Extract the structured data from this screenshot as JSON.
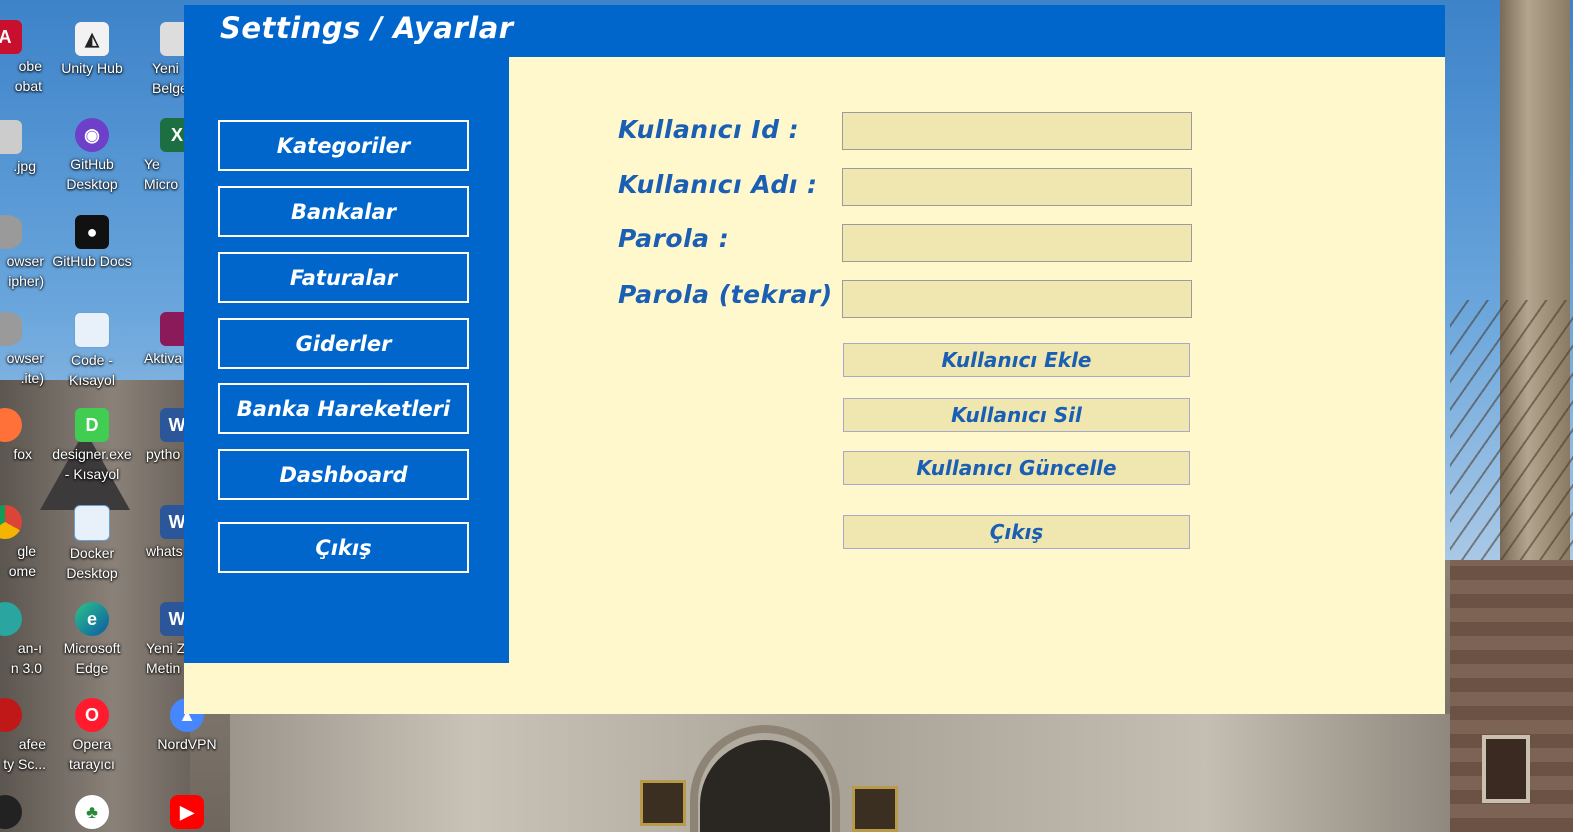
{
  "window": {
    "title": "Settings / Ayarlar"
  },
  "sidebar": {
    "items": [
      {
        "label": "Kategoriler"
      },
      {
        "label": "Bankalar"
      },
      {
        "label": "Faturalar"
      },
      {
        "label": "Giderler"
      },
      {
        "label": "Banka Hareketleri"
      },
      {
        "label": "Dashboard"
      },
      {
        "label": "Çıkış"
      }
    ]
  },
  "form": {
    "fields": [
      {
        "label": "Kullanıcı Id :",
        "value": ""
      },
      {
        "label": "Kullanıcı Adı :",
        "value": ""
      },
      {
        "label": "Parola :",
        "value": ""
      },
      {
        "label": "Parola (tekrar) :",
        "value": ""
      }
    ],
    "buttons": [
      {
        "label": "Kullanıcı Ekle"
      },
      {
        "label": "Kullanıcı Sil"
      },
      {
        "label": "Kullanıcı Güncelle"
      },
      {
        "label": "Çıkış"
      }
    ]
  },
  "desktop": {
    "icons": [
      {
        "label": "obe\nobat",
        "icon": "acrobat-icon"
      },
      {
        "label": "Unity Hub",
        "icon": "unity-icon"
      },
      {
        "label": "Yeni\nBelge",
        "icon": "document-icon"
      },
      {
        "label": ".jpg",
        "icon": "image-icon"
      },
      {
        "label": "GitHub\nDesktop",
        "icon": "github-desktop-icon"
      },
      {
        "label": "Ye\nMicro",
        "icon": "excel-icon"
      },
      {
        "label": "owser\nipher)",
        "icon": "database-icon"
      },
      {
        "label": "GitHub Docs",
        "icon": "github-icon"
      },
      {
        "label": "owser\n.ite)",
        "icon": "database-icon"
      },
      {
        "label": "Code -\nKısayol",
        "icon": "shortcut-icon"
      },
      {
        "label": "Aktiva",
        "icon": "archive-icon"
      },
      {
        "label": "fox",
        "icon": "firefox-icon"
      },
      {
        "label": "designer.exe\n- Kısayol",
        "icon": "designer-icon"
      },
      {
        "label": "pytho",
        "icon": "word-icon"
      },
      {
        "label": "gle\nome",
        "icon": "chrome-icon"
      },
      {
        "label": "Docker\nDesktop",
        "icon": "shortcut-icon"
      },
      {
        "label": "whats",
        "icon": "word-icon"
      },
      {
        "label": "an-ı\nn 3.0",
        "icon": "app-icon"
      },
      {
        "label": "Microsoft\nEdge",
        "icon": "edge-icon"
      },
      {
        "label": "Yeni Z\nMetin",
        "icon": "word-icon"
      },
      {
        "label": "afee\nty Sc...",
        "icon": "mcafee-icon"
      },
      {
        "label": "Opera\ntarayıcı",
        "icon": "opera-icon"
      },
      {
        "label": "NordVPN",
        "icon": "nordvpn-icon"
      }
    ],
    "colors": {
      "accent": "#0066cc",
      "form_bg": "#fff8cc",
      "input_bg": "#f0e6b0",
      "label_text": "#1a5fb4"
    }
  }
}
